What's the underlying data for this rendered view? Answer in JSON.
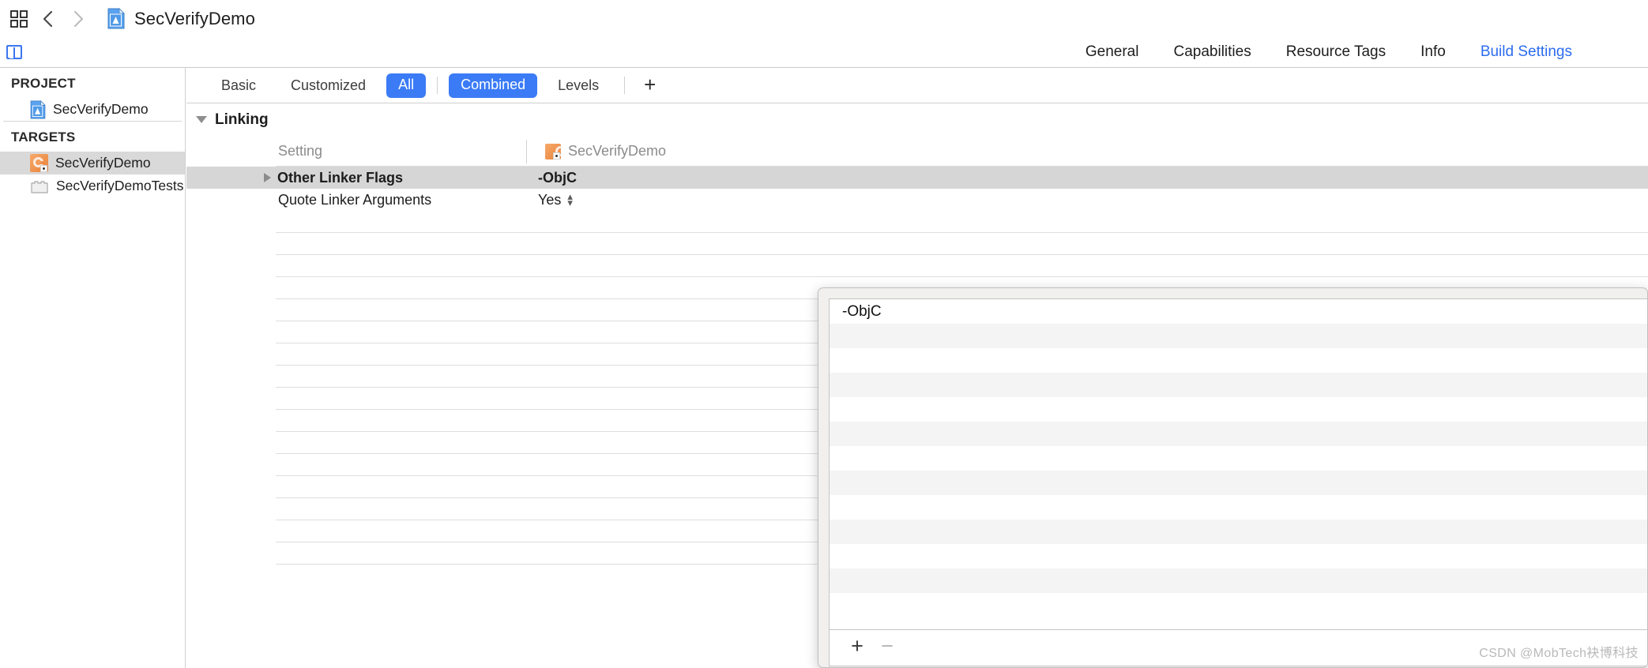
{
  "titlebar": {
    "grid_icon": "grid-icon",
    "back_icon": "chevron-left-icon",
    "forward_icon": "chevron-right-icon",
    "project_icon": "xcode-project-icon",
    "title": "SecVerifyDemo"
  },
  "tabs": [
    {
      "label": "General",
      "active": false
    },
    {
      "label": "Capabilities",
      "active": false
    },
    {
      "label": "Resource Tags",
      "active": false
    },
    {
      "label": "Info",
      "active": false
    },
    {
      "label": "Build Settings",
      "active": true
    }
  ],
  "sidebar": {
    "project_header": "PROJECT",
    "project_items": [
      {
        "label": "SecVerifyDemo",
        "icon": "xcode-project-icon",
        "selected": false
      }
    ],
    "targets_header": "TARGETS",
    "target_items": [
      {
        "label": "SecVerifyDemo",
        "icon": "app-target-icon",
        "selected": true
      },
      {
        "label": "SecVerifyDemoTests",
        "icon": "test-bundle-icon",
        "selected": false
      }
    ]
  },
  "filterbar": {
    "basic": "Basic",
    "customized": "Customized",
    "all": "All",
    "combined": "Combined",
    "levels": "Levels",
    "add": "+"
  },
  "settings": {
    "group_title": "Linking",
    "col_setting": "Setting",
    "col_target": "SecVerifyDemo",
    "rows": [
      {
        "name": "Other Linker Flags",
        "value": "-ObjC",
        "selected": true,
        "expandable": true,
        "stepper": false
      },
      {
        "name": "Quote Linker Arguments",
        "value": "Yes",
        "selected": false,
        "expandable": false,
        "stepper": true
      }
    ]
  },
  "popover": {
    "values": [
      "-ObjC"
    ],
    "add_label": "+",
    "remove_label": "−"
  },
  "watermark": "CSDN @MobTech袂博科技",
  "colors": {
    "accent": "#3b7bf6",
    "tab_active": "#2b6cf0",
    "selection": "#d6d6d6",
    "sidebar_selection": "#d9d9d9"
  }
}
